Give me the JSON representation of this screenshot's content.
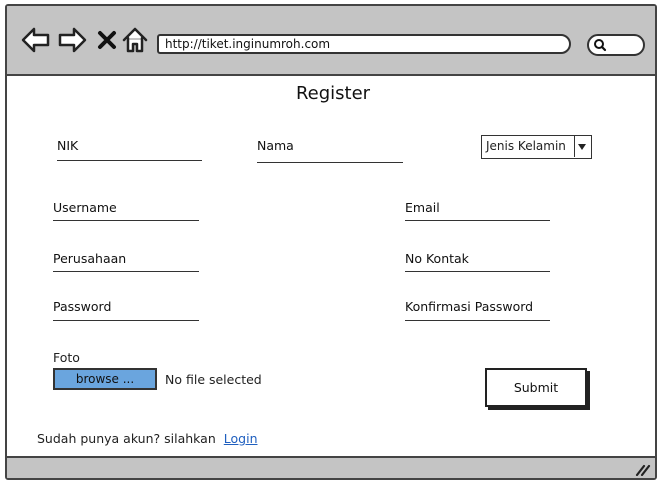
{
  "browser": {
    "url": "http://tiket.inginumroh.com"
  },
  "form": {
    "title": "Register",
    "nik_label": "NIK",
    "nama_label": "Nama",
    "gender_select": "Jenis Kelamin",
    "username_label": "Username",
    "email_label": "Email",
    "perusahaan_label": "Perusahaan",
    "kontak_label": "No Kontak",
    "password_label": "Password",
    "konfirmasi_label": "Konfirmasi Password",
    "foto_label": "Foto",
    "browse_label": "browse ...",
    "file_status": "No file selected",
    "submit_label": "Submit",
    "login_prompt": "Sudah punya akun? silahkan",
    "login_link": "Login"
  },
  "icons": {
    "back": "arrow-left-icon",
    "forward": "arrow-right-icon",
    "stop": "close-icon",
    "home": "home-icon",
    "search": "search-icon",
    "resize": "resize-grip-icon",
    "dropdown": "chevron-down-icon"
  },
  "colors": {
    "chrome": "#c4c4c4",
    "browse_button": "#6aa5de",
    "link": "#1f5fbf"
  }
}
